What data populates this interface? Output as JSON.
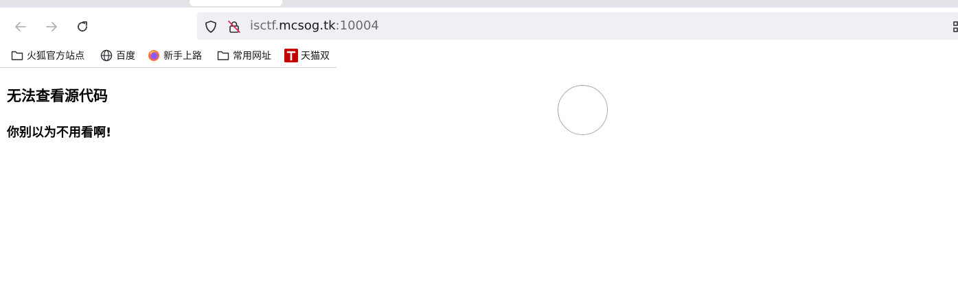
{
  "browser": {
    "url": {
      "prefix": "isctf.",
      "domain": "mcsog.tk",
      "port": ":10004"
    },
    "icons": {
      "back": "arrow-left-icon",
      "forward": "arrow-right-icon",
      "reload": "reload-icon",
      "tracking": "shield-icon",
      "security": "insecure-lock-icon",
      "extension": "qr-code-icon"
    }
  },
  "bookmarks": [
    {
      "label": "火狐官方站点",
      "icon": "folder-icon"
    },
    {
      "label": "百度",
      "icon": "globe-icon"
    },
    {
      "label": "新手上路",
      "icon": "firefox-icon"
    },
    {
      "label": "常用网址",
      "icon": "folder-icon"
    },
    {
      "label": "天猫双",
      "icon": "tmall-icon"
    }
  ],
  "ghost_bookmarks": [
    "",
    "",
    "",
    "",
    ""
  ],
  "page": {
    "heading": "无法查看源代码",
    "subheading": "你别以为不用看啊!"
  },
  "colors": {
    "tabstrip": "#e1e3e8",
    "urlbar": "#f0f0f4",
    "tmall": "#c40000"
  }
}
